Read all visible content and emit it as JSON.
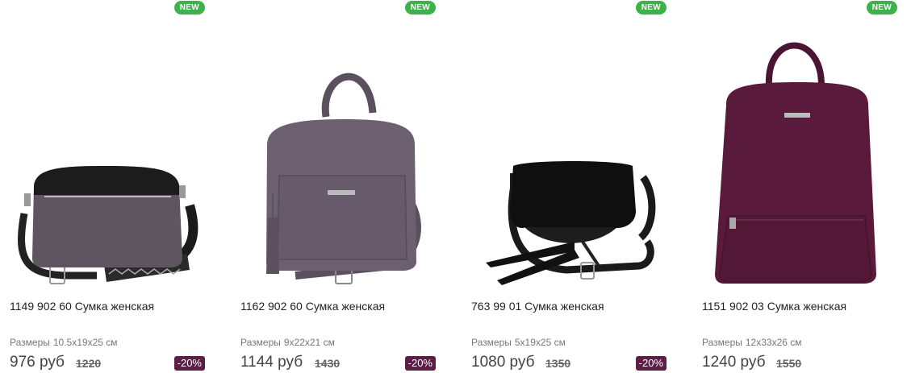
{
  "products": [
    {
      "badge": "NEW",
      "title": "1149 902 60 Сумка женская",
      "sizes_label": "Размеры",
      "sizes_value": "10.5x19x25 см",
      "price": "976 руб",
      "old_price": "1220",
      "discount": "-20%",
      "color": "#5e5560"
    },
    {
      "badge": "NEW",
      "title": "1162 902 60 Сумка женская",
      "sizes_label": "Размеры",
      "sizes_value": "9x22x21 см",
      "price": "1144 руб",
      "old_price": "1430",
      "discount": "-20%",
      "color": "#6c6070"
    },
    {
      "badge": "NEW",
      "title": "763 99 01 Сумка женская",
      "sizes_label": "Размеры",
      "sizes_value": "5x19x25 см",
      "price": "1080 руб",
      "old_price": "1350",
      "discount": "-20%",
      "color": "#151515"
    },
    {
      "badge": "NEW",
      "title": "1151 902 03 Сумка женская",
      "sizes_label": "Размеры",
      "sizes_value": "12x33x26 см",
      "price": "1240 руб",
      "old_price": "1550",
      "discount": "",
      "color": "#5a1a3c"
    }
  ],
  "colors": {
    "new_badge": "#3fb14a",
    "discount_badge": "#5b1e45"
  }
}
